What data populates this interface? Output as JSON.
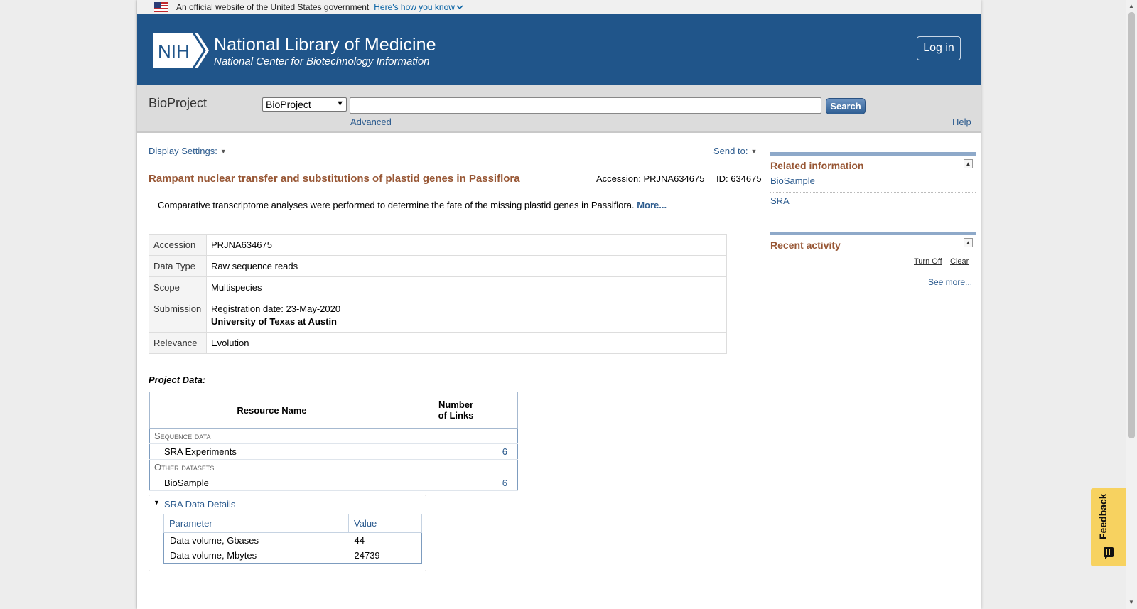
{
  "gov_banner": {
    "text": "An official website of the United States government",
    "link": "Here's how you know"
  },
  "header": {
    "logo_text": "NIH",
    "title": "National Library of Medicine",
    "subtitle": "National Center for Biotechnology Information",
    "login_label": "Log in",
    "bg_color": "#20558a"
  },
  "search": {
    "db_title": "BioProject",
    "db_selected": "BioProject",
    "query": "",
    "button_label": "Search",
    "advanced_label": "Advanced",
    "help_label": "Help"
  },
  "toolbar": {
    "display_settings": "Display Settings:",
    "send_to": "Send to:"
  },
  "project": {
    "title": "Rampant nuclear transfer and substitutions of plastid genes in Passiflora",
    "accession_header": "Accession: PRJNA634675",
    "id_header": "ID: 634675",
    "description": "Comparative transcriptome analyses were performed to determine the fate of the missing plastid genes in Passiflora.",
    "more_label": "More...",
    "title_color": "#985735"
  },
  "info": [
    {
      "key": "Accession",
      "value": "PRJNA634675"
    },
    {
      "key": "Data Type",
      "value": "Raw sequence reads"
    },
    {
      "key": "Scope",
      "value": "Multispecies"
    },
    {
      "key": "Submission",
      "value": "Registration date: 23-May-2020",
      "extra": "University of Texas at Austin"
    },
    {
      "key": "Relevance",
      "value": "Evolution"
    }
  ],
  "project_data": {
    "label": "Project Data:",
    "col_resource": "Resource Name",
    "col_links_line1": "Number",
    "col_links_line2": "of Links",
    "groups": [
      {
        "category": "Sequence data",
        "rows": [
          {
            "name": "SRA Experiments",
            "count": "6"
          }
        ]
      },
      {
        "category": "Other datasets",
        "rows": [
          {
            "name": "BioSample",
            "count": "6"
          }
        ]
      }
    ]
  },
  "sra_details": {
    "title": "SRA Data Details",
    "col_param": "Parameter",
    "col_value": "Value",
    "rows": [
      {
        "param": "Data volume, Gbases",
        "value": "44"
      },
      {
        "param": "Data volume, Mbytes",
        "value": "24739"
      }
    ]
  },
  "sidebar": {
    "related_title": "Related information",
    "related_links": [
      "BioSample",
      "SRA"
    ],
    "recent_title": "Recent activity",
    "turn_off": "Turn Off",
    "clear": "Clear",
    "see_more": "See more..."
  },
  "feedback": {
    "label": "Feedback",
    "color": "#f7d260"
  }
}
